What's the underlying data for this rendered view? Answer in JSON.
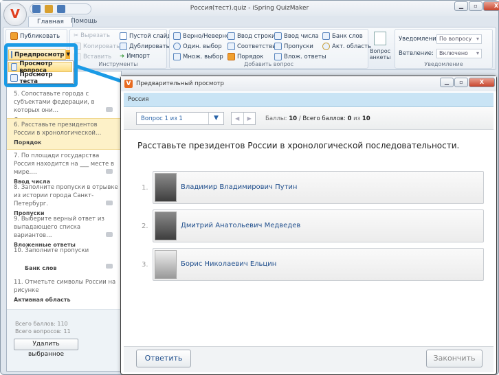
{
  "window": {
    "title": "Россия(тест).quiz - iSpring QuizMaker",
    "logo": "V"
  },
  "tabs": [
    {
      "label": "Главная"
    },
    {
      "label": "Помощь"
    }
  ],
  "ribbon": {
    "publish": "Публиковать",
    "preview": "Предпросмотр",
    "preview_menu": [
      "Просмотр вопроса",
      "Просмотр теста"
    ],
    "tools": {
      "cut": "Вырезать",
      "copy": "Копировать",
      "paste": "Вставить",
      "blank": "Пустой слайд",
      "duplicate": "Дублировать",
      "import": "Импорт",
      "label": "Инструменты"
    },
    "add": {
      "items": [
        "Верно/Неверно",
        "Один. выбор",
        "Множ. выбор",
        "Ввод строки",
        "Соответствие",
        "Порядок",
        "Ввод числа",
        "Пропуски",
        "Влож. ответы",
        "Банк слов",
        "Акт. область"
      ],
      "survey": "Вопрос анкеты",
      "label": "Добавить вопрос"
    },
    "notify": {
      "notify_label": "Уведомление:",
      "notify_value": "По вопросу",
      "branch_label": "Ветвление:",
      "branch_value": "Включено",
      "label": "Уведомление"
    }
  },
  "questions": [
    {
      "num": "5.",
      "text": "Сопоставьте города с субъектами федерации, в которых они…",
      "type": "Сопоставление"
    },
    {
      "num": "6.",
      "text": "Расставьте президентов России в хронологической…",
      "type": "Порядок"
    },
    {
      "num": "7.",
      "text": "По площади государства Россия находится на ___ месте в мире.…",
      "type": "Ввод числа"
    },
    {
      "num": "8.",
      "text": "Заполните пропуски в отрывке из истории города Санкт-Петербург.",
      "type": "Пропуски"
    },
    {
      "num": "9.",
      "text": "Выберите верный ответ из выпадающего списка вариантов…",
      "type": "Вложенные ответы"
    },
    {
      "num": "10.",
      "text": "Заполните пропуски",
      "type": "Банк слов"
    },
    {
      "num": "11.",
      "text": "Отметьте символы России на рисунке",
      "type": "Активная область"
    }
  ],
  "summary": {
    "total_points": "Всего баллов: 110",
    "total_questions": "Всего вопросов: 11",
    "delete": "Удалить выбранное"
  },
  "preview": {
    "title": "Предварительный просмотр",
    "quiz_name": "Россия",
    "question_select": "Вопрос 1 из 1",
    "points_label": "Баллы:",
    "points": "10",
    "sep": "/",
    "total_label": "Всего баллов:",
    "scored": "0",
    "of": "из",
    "total": "10",
    "question": "Расставьте президентов России в хронологической последовательности.",
    "answers": [
      {
        "num": "1.",
        "name": "Владимир Владимирович Путин"
      },
      {
        "num": "2.",
        "name": "Дмитрий Анатольевич Медведев"
      },
      {
        "num": "3.",
        "name": "Борис Николаевич Ельцин"
      }
    ],
    "submit": "Ответить",
    "finish": "Закончить"
  },
  "colors": {
    "callout": "#1a9be6",
    "header": "#c9e4f5",
    "selected": "#fdf1c8"
  }
}
